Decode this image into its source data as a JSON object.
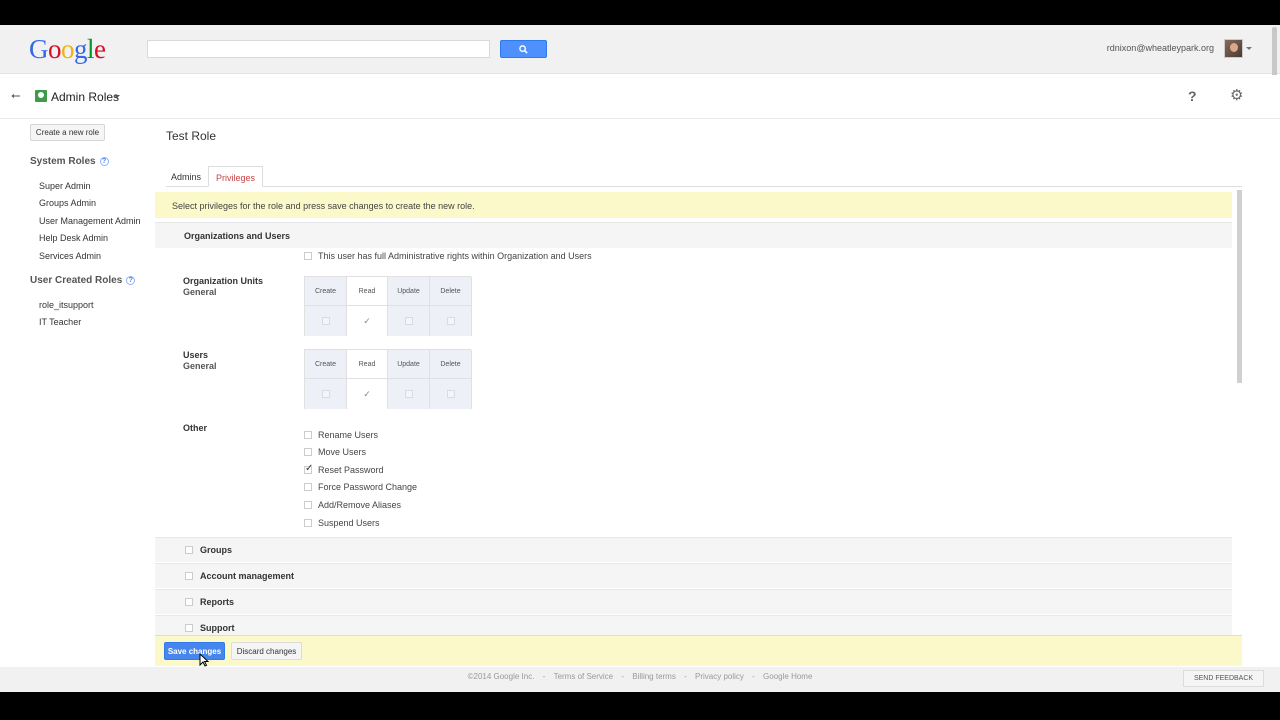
{
  "topbar": {
    "logo": {
      "g1": "G",
      "o1": "o",
      "o2": "o",
      "g2": "g",
      "l": "l",
      "e": "e"
    },
    "search_placeholder": "",
    "user_email": "rdnixon@wheatleypark.org"
  },
  "subbar": {
    "title": "Admin Roles",
    "help_glyph": "?",
    "gear_glyph": "⚙",
    "back_glyph": "⭠"
  },
  "sidebar": {
    "create_button": "Create a new role",
    "system_roles_heading": "System Roles",
    "system_roles": [
      "Super Admin",
      "Groups Admin",
      "User Management Admin",
      "Help Desk Admin",
      "Services Admin"
    ],
    "user_roles_heading": "User Created Roles",
    "user_roles": [
      "role_itsupport",
      "IT Teacher"
    ],
    "help_glyph": "?"
  },
  "main": {
    "role_title": "Test Role",
    "tabs": [
      {
        "label": "Admins"
      },
      {
        "label": "Privileges",
        "active": true
      }
    ],
    "banner": "Select privileges for the role and press save changes to create the new role.",
    "section_title": "Organizations and Users",
    "full_rights_label": "This user has full Administrative rights within Organization and Users",
    "permission_tables": [
      {
        "title": "Organization Units",
        "subtitle": "General",
        "columns": [
          "Create",
          "Read",
          "Update",
          "Delete"
        ],
        "checked": [
          false,
          true,
          false,
          false
        ]
      },
      {
        "title": "Users",
        "subtitle": "General",
        "columns": [
          "Create",
          "Read",
          "Update",
          "Delete"
        ],
        "checked": [
          false,
          true,
          false,
          false
        ]
      }
    ],
    "other_label": "Other",
    "other_items": [
      {
        "label": "Rename Users",
        "checked": false
      },
      {
        "label": "Move Users",
        "checked": false
      },
      {
        "label": "Reset Password",
        "checked": true
      },
      {
        "label": "Force Password Change",
        "checked": false
      },
      {
        "label": "Add/Remove Aliases",
        "checked": false
      },
      {
        "label": "Suspend Users",
        "checked": false
      }
    ],
    "collapsed_sections": [
      "Groups",
      "Account management",
      "Reports",
      "Support"
    ]
  },
  "actions": {
    "save": "Save changes",
    "discard": "Discard changes"
  },
  "footer": {
    "copyright": "©2014 Google Inc.",
    "links": [
      "Terms of Service",
      "Billing terms",
      "Privacy policy",
      "Google Home"
    ],
    "separator": "-",
    "feedback": "SEND FEEDBACK"
  },
  "colors": {
    "accent_blue": "#4787ed",
    "banner_yellow": "#fbf8c9",
    "active_tab_red": "#cc4444"
  }
}
